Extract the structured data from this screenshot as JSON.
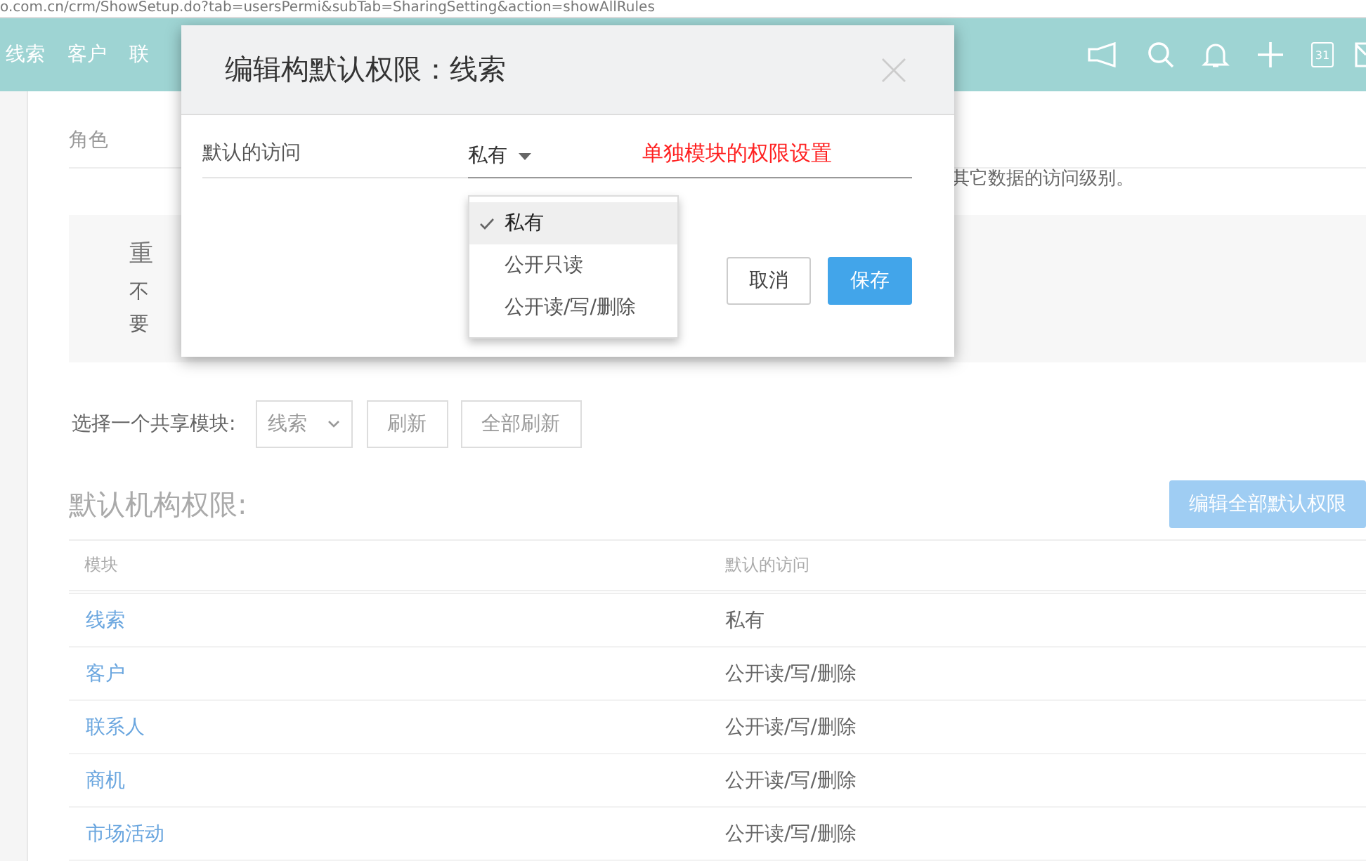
{
  "address_bar": {
    "url": "o.com.cn/crm/ShowSetup.do?tab=usersPermi&subTab=SharingSetting&action=showAllRules"
  },
  "nav": {
    "items": [
      "线索",
      "客户",
      "联"
    ],
    "calendar_day": "31"
  },
  "tabs": [
    {
      "label": "角色",
      "selected": false
    }
  ],
  "intro_fragment": "其它数据的访问级别。",
  "notice": {
    "title_fragment": "重",
    "line_fragments": [
      "不",
      "要"
    ]
  },
  "module_picker": {
    "label": "选择一个共享模块:",
    "value": "线索",
    "buttons": [
      "刷新",
      "全部刷新"
    ]
  },
  "section": {
    "title": "默认机构权限:",
    "edit_button": "编辑全部默认权限"
  },
  "table": {
    "columns": [
      "模块",
      "默认的访问"
    ],
    "rows": [
      {
        "module": "线索",
        "access": "私有"
      },
      {
        "module": "客户",
        "access": "公开读/写/删除"
      },
      {
        "module": "联系人",
        "access": "公开读/写/删除"
      },
      {
        "module": "商机",
        "access": "公开读/写/删除"
      },
      {
        "module": "市场活动",
        "access": "公开读/写/删除"
      }
    ]
  },
  "dialog": {
    "title": "编辑构默认权限：线索",
    "field_label": "默认的访问",
    "field_value": "私有",
    "annotation": "单独模块的权限设置",
    "options": [
      {
        "label": "私有",
        "selected": true
      },
      {
        "label": "公开只读",
        "selected": false
      },
      {
        "label": "公开读/写/删除",
        "selected": false
      }
    ],
    "buttons": [
      {
        "label": "取消",
        "kind": "secondary"
      },
      {
        "label": "保存",
        "kind": "primary"
      }
    ]
  }
}
